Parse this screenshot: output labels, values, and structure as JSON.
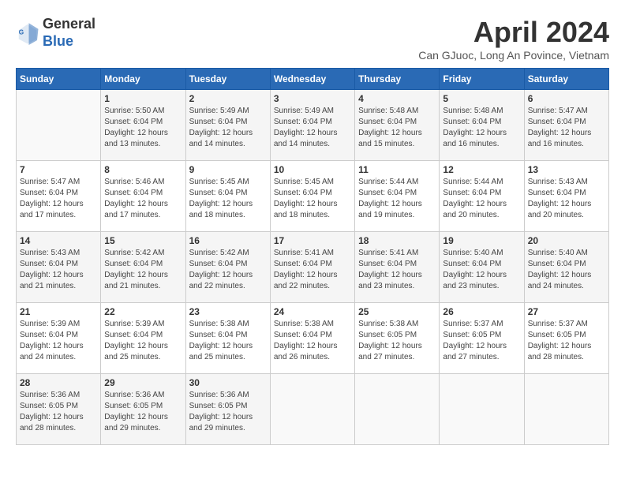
{
  "logo": {
    "line1": "General",
    "line2": "Blue"
  },
  "title": "April 2024",
  "location": "Can GJuoc, Long An Povince, Vietnam",
  "headers": [
    "Sunday",
    "Monday",
    "Tuesday",
    "Wednesday",
    "Thursday",
    "Friday",
    "Saturday"
  ],
  "weeks": [
    [
      {
        "day": "",
        "info": ""
      },
      {
        "day": "1",
        "info": "Sunrise: 5:50 AM\nSunset: 6:04 PM\nDaylight: 12 hours\nand 13 minutes."
      },
      {
        "day": "2",
        "info": "Sunrise: 5:49 AM\nSunset: 6:04 PM\nDaylight: 12 hours\nand 14 minutes."
      },
      {
        "day": "3",
        "info": "Sunrise: 5:49 AM\nSunset: 6:04 PM\nDaylight: 12 hours\nand 14 minutes."
      },
      {
        "day": "4",
        "info": "Sunrise: 5:48 AM\nSunset: 6:04 PM\nDaylight: 12 hours\nand 15 minutes."
      },
      {
        "day": "5",
        "info": "Sunrise: 5:48 AM\nSunset: 6:04 PM\nDaylight: 12 hours\nand 16 minutes."
      },
      {
        "day": "6",
        "info": "Sunrise: 5:47 AM\nSunset: 6:04 PM\nDaylight: 12 hours\nand 16 minutes."
      }
    ],
    [
      {
        "day": "7",
        "info": "Sunrise: 5:47 AM\nSunset: 6:04 PM\nDaylight: 12 hours\nand 17 minutes."
      },
      {
        "day": "8",
        "info": "Sunrise: 5:46 AM\nSunset: 6:04 PM\nDaylight: 12 hours\nand 17 minutes."
      },
      {
        "day": "9",
        "info": "Sunrise: 5:45 AM\nSunset: 6:04 PM\nDaylight: 12 hours\nand 18 minutes."
      },
      {
        "day": "10",
        "info": "Sunrise: 5:45 AM\nSunset: 6:04 PM\nDaylight: 12 hours\nand 18 minutes."
      },
      {
        "day": "11",
        "info": "Sunrise: 5:44 AM\nSunset: 6:04 PM\nDaylight: 12 hours\nand 19 minutes."
      },
      {
        "day": "12",
        "info": "Sunrise: 5:44 AM\nSunset: 6:04 PM\nDaylight: 12 hours\nand 20 minutes."
      },
      {
        "day": "13",
        "info": "Sunrise: 5:43 AM\nSunset: 6:04 PM\nDaylight: 12 hours\nand 20 minutes."
      }
    ],
    [
      {
        "day": "14",
        "info": "Sunrise: 5:43 AM\nSunset: 6:04 PM\nDaylight: 12 hours\nand 21 minutes."
      },
      {
        "day": "15",
        "info": "Sunrise: 5:42 AM\nSunset: 6:04 PM\nDaylight: 12 hours\nand 21 minutes."
      },
      {
        "day": "16",
        "info": "Sunrise: 5:42 AM\nSunset: 6:04 PM\nDaylight: 12 hours\nand 22 minutes."
      },
      {
        "day": "17",
        "info": "Sunrise: 5:41 AM\nSunset: 6:04 PM\nDaylight: 12 hours\nand 22 minutes."
      },
      {
        "day": "18",
        "info": "Sunrise: 5:41 AM\nSunset: 6:04 PM\nDaylight: 12 hours\nand 23 minutes."
      },
      {
        "day": "19",
        "info": "Sunrise: 5:40 AM\nSunset: 6:04 PM\nDaylight: 12 hours\nand 23 minutes."
      },
      {
        "day": "20",
        "info": "Sunrise: 5:40 AM\nSunset: 6:04 PM\nDaylight: 12 hours\nand 24 minutes."
      }
    ],
    [
      {
        "day": "21",
        "info": "Sunrise: 5:39 AM\nSunset: 6:04 PM\nDaylight: 12 hours\nand 24 minutes."
      },
      {
        "day": "22",
        "info": "Sunrise: 5:39 AM\nSunset: 6:04 PM\nDaylight: 12 hours\nand 25 minutes."
      },
      {
        "day": "23",
        "info": "Sunrise: 5:38 AM\nSunset: 6:04 PM\nDaylight: 12 hours\nand 25 minutes."
      },
      {
        "day": "24",
        "info": "Sunrise: 5:38 AM\nSunset: 6:04 PM\nDaylight: 12 hours\nand 26 minutes."
      },
      {
        "day": "25",
        "info": "Sunrise: 5:38 AM\nSunset: 6:05 PM\nDaylight: 12 hours\nand 27 minutes."
      },
      {
        "day": "26",
        "info": "Sunrise: 5:37 AM\nSunset: 6:05 PM\nDaylight: 12 hours\nand 27 minutes."
      },
      {
        "day": "27",
        "info": "Sunrise: 5:37 AM\nSunset: 6:05 PM\nDaylight: 12 hours\nand 28 minutes."
      }
    ],
    [
      {
        "day": "28",
        "info": "Sunrise: 5:36 AM\nSunset: 6:05 PM\nDaylight: 12 hours\nand 28 minutes."
      },
      {
        "day": "29",
        "info": "Sunrise: 5:36 AM\nSunset: 6:05 PM\nDaylight: 12 hours\nand 29 minutes."
      },
      {
        "day": "30",
        "info": "Sunrise: 5:36 AM\nSunset: 6:05 PM\nDaylight: 12 hours\nand 29 minutes."
      },
      {
        "day": "",
        "info": ""
      },
      {
        "day": "",
        "info": ""
      },
      {
        "day": "",
        "info": ""
      },
      {
        "day": "",
        "info": ""
      }
    ]
  ]
}
